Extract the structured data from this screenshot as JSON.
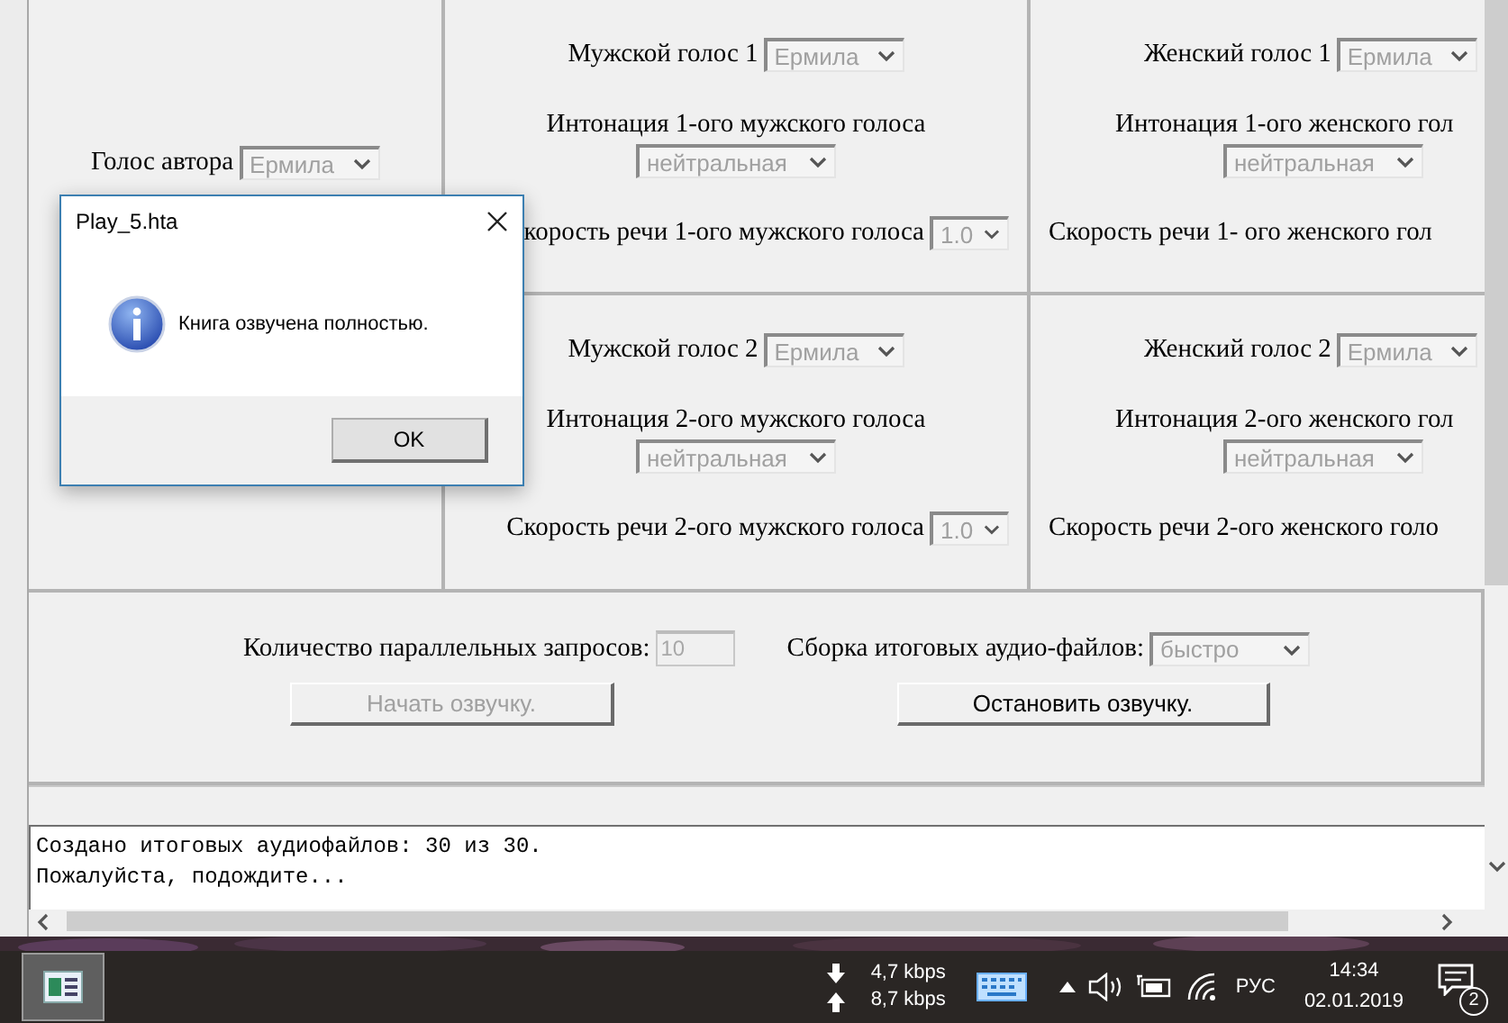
{
  "author": {
    "label": "Голос автора",
    "voice": "Ермила"
  },
  "voices": [
    {
      "kind": "male",
      "label": "Мужской голос 1",
      "voice": "Ермила",
      "intonation_label": "Интонация 1-ого мужского голоса",
      "intonation": "нейтральная",
      "speed_label": "корость речи 1-ого мужского голоса",
      "speed": "1.0"
    },
    {
      "kind": "female",
      "label": "Женский голос 1",
      "voice": "Ермила",
      "intonation_label": "Интонация 1-ого женского гол",
      "intonation": "нейтральная",
      "speed_label": "Скорость речи 1- ого женского гол"
    },
    {
      "kind": "male",
      "label": "Мужской голос 2",
      "voice": "Ермила",
      "intonation_label": "Интонация 2-ого мужского голоса",
      "intonation": "нейтральная",
      "speed_label": "Скорость речи 2-ого мужского голоса",
      "speed": "1.0"
    },
    {
      "kind": "female",
      "label": "Женский голос 2",
      "voice": "Ермила",
      "intonation_label": "Интонация 2-ого женского гол",
      "intonation": "нейтральная",
      "speed_label": "Скорость речи 2-ого женского голо"
    }
  ],
  "settings": {
    "requests_label": "Количество параллельных запросов:",
    "requests": "10",
    "assembly_label": "Сборка итоговых аудио-файлов:",
    "assembly": "быстро"
  },
  "buttons": [
    {
      "label": "Начать озвучку.",
      "disabled": true
    },
    {
      "label": "Остановить озвучку.",
      "disabled": false
    }
  ],
  "log": [
    "Создано итоговых аудиофайлов: 30 из 30.",
    "Пожалуйста, подождите..."
  ],
  "dialog": {
    "title": "Play_5.hta",
    "message": "Книга озвучена полностью.",
    "button": "OK"
  },
  "taskbar": {
    "download": "4,7 kbps",
    "upload": "8,7 kbps",
    "language": "РУС",
    "time": "14:34",
    "date": "02.01.2019",
    "notifications": "2"
  }
}
